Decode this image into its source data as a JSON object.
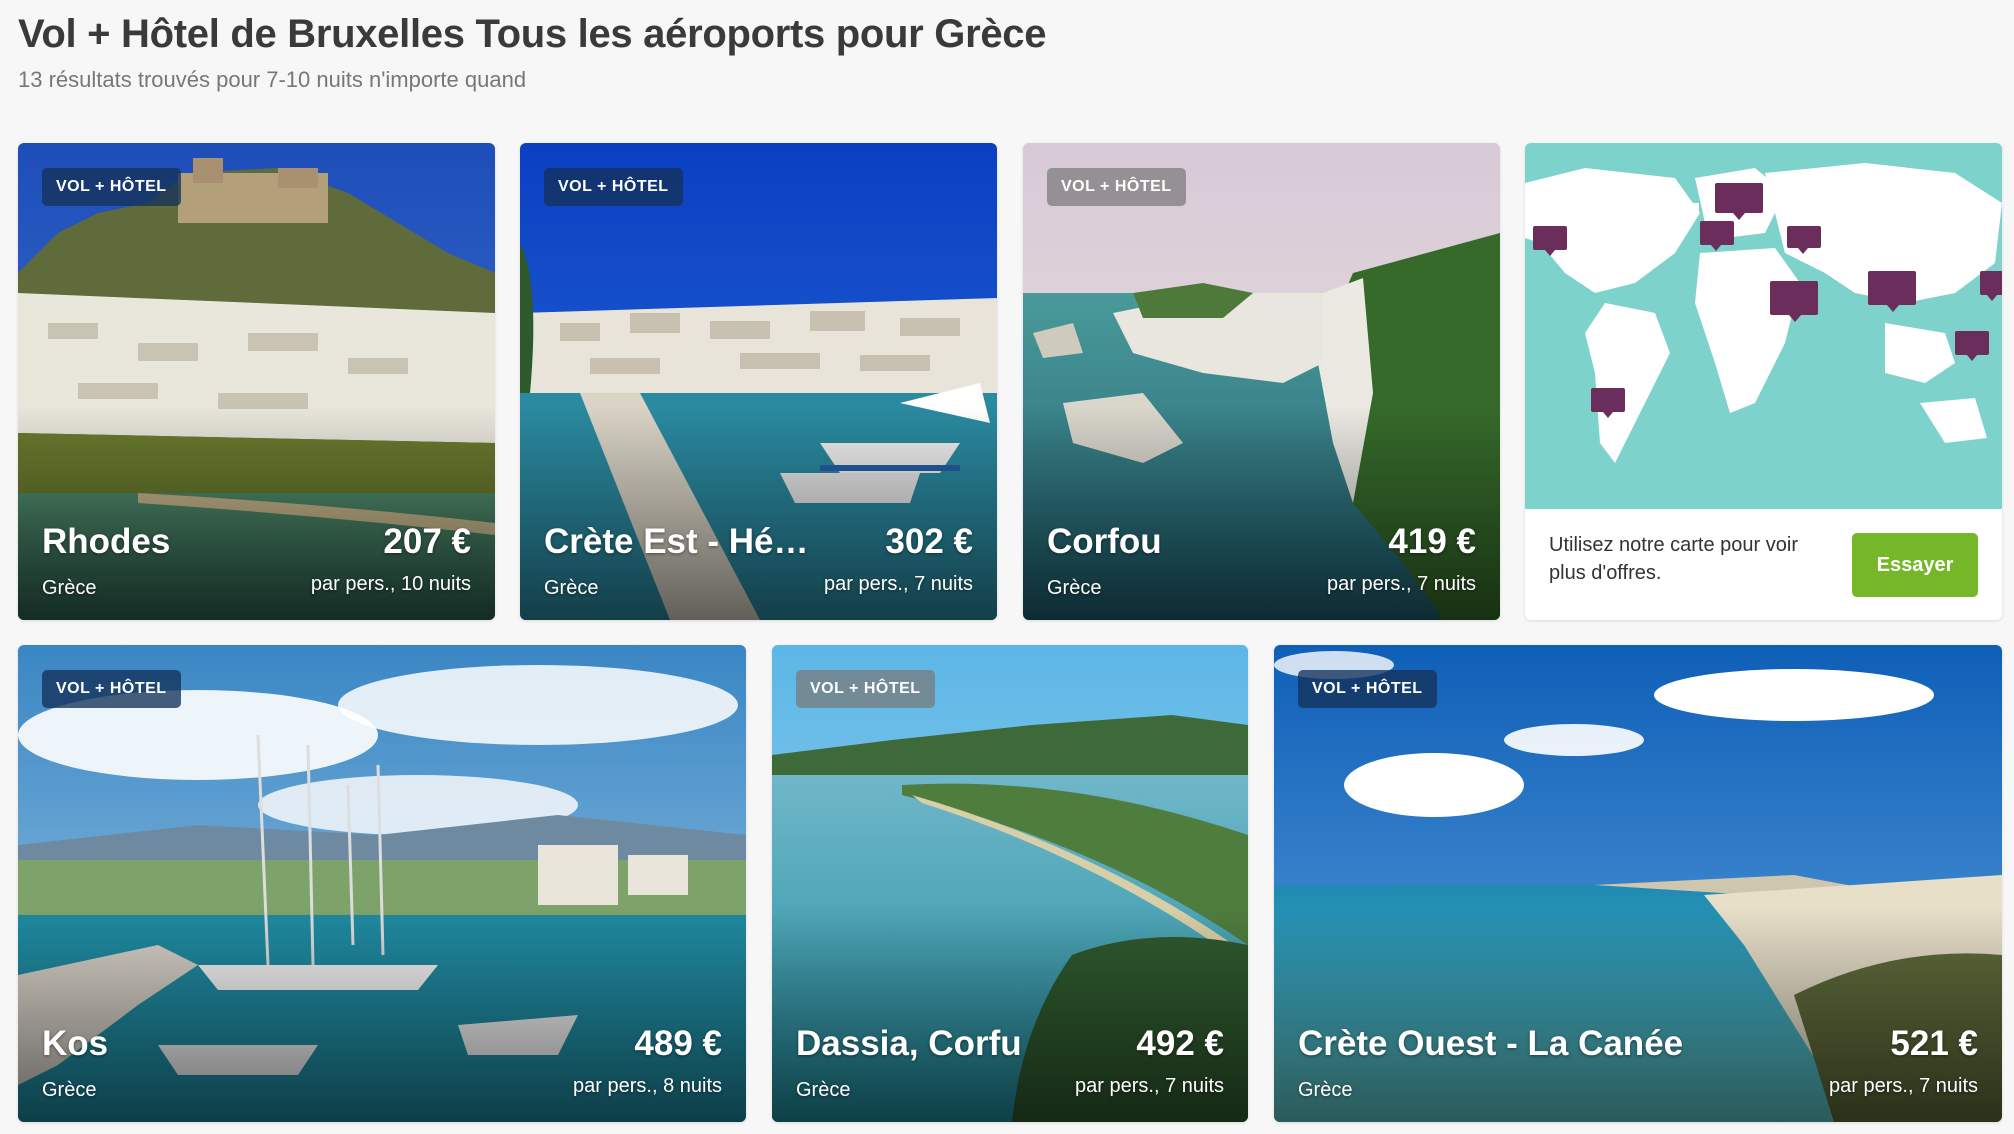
{
  "header": {
    "title": "Vol + Hôtel de Bruxelles Tous les aéroports pour Grèce",
    "subtitle": "13 résultats trouvés pour 7-10 nuits n'importe quand"
  },
  "cards": [
    {
      "badge": "VOL + HÔTEL",
      "name": "Rhodes",
      "country": "Grèce",
      "price": "207 €",
      "per": "par pers., 10 nuits"
    },
    {
      "badge": "VOL + HÔTEL",
      "name": "Crète Est - Hér…",
      "country": "Grèce",
      "price": "302 €",
      "per": "par pers., 7 nuits"
    },
    {
      "badge": "VOL + HÔTEL",
      "name": "Corfou",
      "country": "Grèce",
      "price": "419 €",
      "per": "par pers., 7 nuits"
    },
    {
      "badge": "VOL + HÔTEL",
      "name": "Kos",
      "country": "Grèce",
      "price": "489 €",
      "per": "par pers., 8 nuits"
    },
    {
      "badge": "VOL + HÔTEL",
      "name": "Dassia, Corfu",
      "country": "Grèce",
      "price": "492 €",
      "per": "par pers., 7 nuits"
    },
    {
      "badge": "VOL + HÔTEL",
      "name": "Crète Ouest - La Canée",
      "country": "Grèce",
      "price": "521 €",
      "per": "par pers., 7 nuits"
    }
  ],
  "map_promo": {
    "text": "Utilisez notre carte pour voir plus d'offres.",
    "button": "Essayer"
  },
  "colors": {
    "accent_button": "#76b72a",
    "map_sea": "#7dd3cb",
    "map_pin": "#6b2d5c",
    "badge": "#14325a"
  }
}
